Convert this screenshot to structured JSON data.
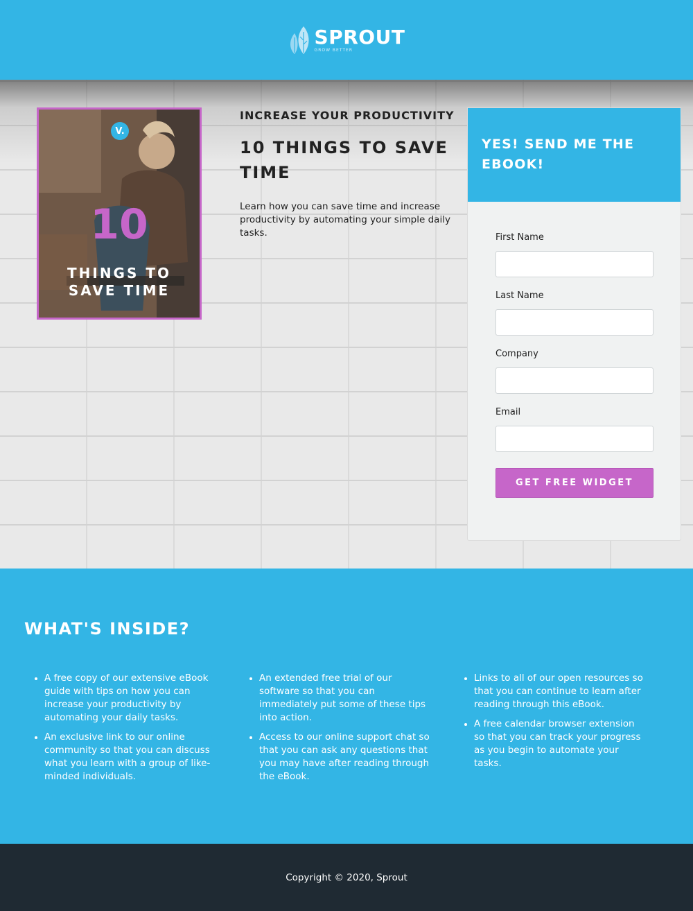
{
  "header": {
    "logo_name": "SPROUT",
    "logo_tagline": "GROW BETTER"
  },
  "hero": {
    "book": {
      "badge": "V.",
      "number": "10",
      "subtitle_line1": "THINGS TO",
      "subtitle_line2": "SAVE TIME"
    },
    "eyebrow": "INCREASE YOUR PRODUCTIVITY",
    "headline": "10 THINGS TO SAVE TIME",
    "lead": "Learn how you can save time and increase productivity by automating your simple daily tasks."
  },
  "form": {
    "title": "YES! SEND ME THE EBOOK!",
    "fields": [
      {
        "label": "First Name",
        "value": ""
      },
      {
        "label": "Last Name",
        "value": ""
      },
      {
        "label": "Company",
        "value": ""
      },
      {
        "label": "Email",
        "value": ""
      }
    ],
    "submit_label": "GET FREE WIDGET"
  },
  "inside": {
    "title": "WHAT'S INSIDE?",
    "columns": [
      {
        "items": [
          "A free copy of our extensive eBook guide with tips on how you can increase your productivity by automating your daily tasks.",
          "An exclusive link to our online community so that you can discuss what you learn with a group of like-minded individuals."
        ]
      },
      {
        "items": [
          "An extended free trial of our software so that you can immediately put some of these tips into action.",
          "Access to our online support chat so that you can ask any questions that you may have after reading through the eBook."
        ]
      },
      {
        "items": [
          "Links to all of our open resources so that you can continue to learn after reading through this eBook.",
          "A free calendar browser extension so that you can track your progress as you begin to automate your tasks."
        ]
      }
    ]
  },
  "footer": {
    "copyright": "Copyright © 2020, Sprout"
  },
  "colors": {
    "brand_blue": "#33b5e5",
    "accent_purple": "#c666c9",
    "footer_dark": "#1f2a33"
  },
  "icons": {
    "logo_mark": "leaf-icon",
    "list_bullet": "bullet-dot"
  }
}
